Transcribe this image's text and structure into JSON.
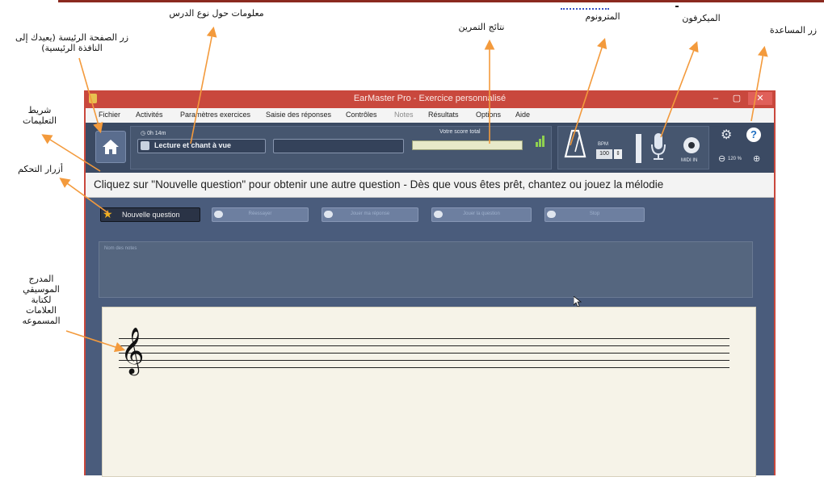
{
  "annotations": {
    "home_button": "زر الصفحة الرئيسة (يعيدك إلى النافذة الرئيسية)",
    "lesson_info": "معلومات حول نوع الدرس",
    "exercise_results": "نتائج التمرين",
    "metronome": "المترونوم",
    "microphone": "الميكرفون",
    "help_button": "زر المساعدة",
    "instruction_bar": "شريط التعليمات",
    "control_buttons": "أزرار التحكم",
    "music_staff": "المدرج الموسيقي لكتابة العلامات المسموعه"
  },
  "window": {
    "title": "EarMaster Pro - Exercice personnalisé",
    "minimize": "–",
    "maximize": "▢",
    "close": "✕"
  },
  "menu": [
    "Fichier",
    "Activités",
    "Paramètres exercices",
    "Saisie des réponses",
    "Contrôles",
    "Notes",
    "Résultats",
    "Options",
    "Aide"
  ],
  "menu_disabled": [
    "Notes"
  ],
  "toolbar": {
    "timer": "0h 14m",
    "lesson_label": "Lecture et chant à vue",
    "score_label": "Votre score total",
    "tempo_unit": "BPM",
    "tempo_value": "100",
    "midi_label": "MIDI IN",
    "zoom_label": "120 %"
  },
  "instruction": "Cliquez sur \"Nouvelle question\" pour obtenir une autre question - Dès que vous êtes prêt, chantez ou jouez la mélodie",
  "controls": {
    "new_question": "Nouvelle question",
    "retry": "Réessayer",
    "play_answer": "Jouer ma réponse",
    "play_question": "Jouer la question",
    "stop": "Stop"
  },
  "notes_panel_label": "Nom des notes",
  "colors": {
    "titlebar": "#c9483d",
    "toolbar": "#3b4a63",
    "content": "#4a5c7c",
    "staff": "#f6f3e8",
    "arrow": "#f39a3c"
  },
  "icons": [
    "home-icon",
    "lesson-icon",
    "graph-icon",
    "metronome-icon",
    "microphone-icon",
    "midi-icon",
    "gear-icon",
    "help-icon",
    "zoom-out-icon",
    "zoom-in-icon",
    "star-icon",
    "treble-clef-icon"
  ]
}
